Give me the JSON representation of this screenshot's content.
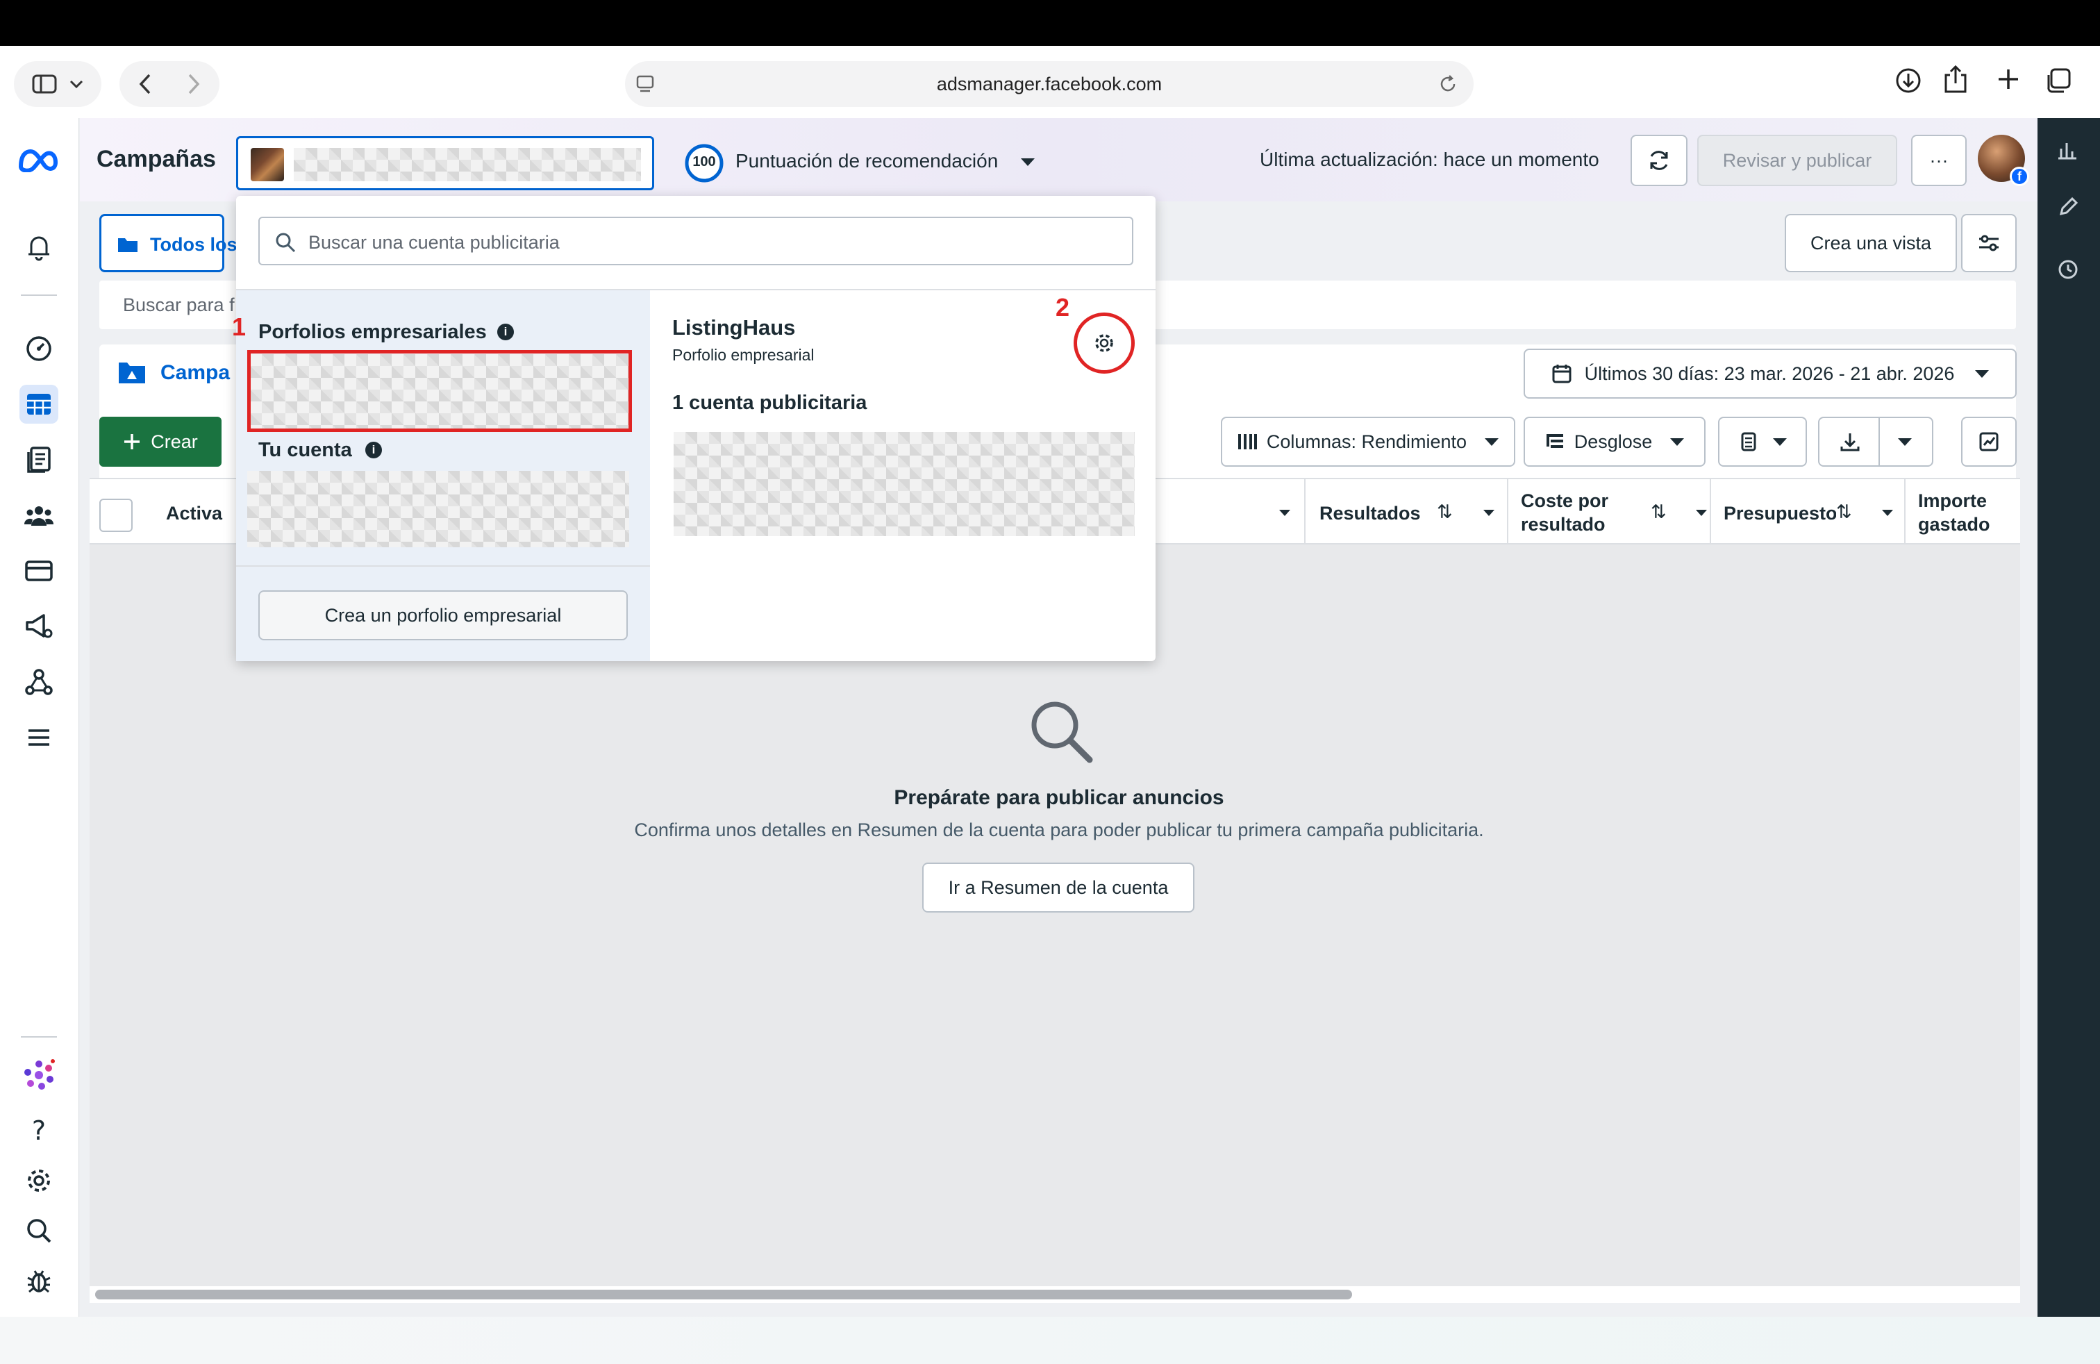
{
  "browser": {
    "url": "adsmanager.facebook.com"
  },
  "header": {
    "title": "Campañas",
    "score_value": "100",
    "score_label": "Puntuación de recomendación",
    "last_update": "Última actualización: hace un momento",
    "review_publish": "Revisar y publicar",
    "more": "···"
  },
  "toolbar_row": {
    "all_label": "Todos los",
    "create_view": "Crea una vista",
    "search_placeholder": "Buscar para f",
    "campaigns_tab": "Campa",
    "date_range": "Últimos 30 días: 23 mar. 2026 - 21 abr. 2026",
    "create_button": "Crear",
    "columns": "Columnas: Rendimiento",
    "breakdown": "Desglose"
  },
  "table": {
    "col_active": "Activa",
    "col_results": "Resultados",
    "col_cost_line1": "Coste por",
    "col_cost_line2": "resultado",
    "col_budget": "Presupuesto",
    "col_spent_line1": "Importe",
    "col_spent_line2": "gastado"
  },
  "empty_state": {
    "title": "Prepárate para publicar anuncios",
    "description": "Confirma unos detalles en Resumen de la cuenta para poder publicar tu primera campaña publicitaria.",
    "button": "Ir a Resumen de la cuenta"
  },
  "dropdown": {
    "search_placeholder": "Buscar una cuenta publicitaria",
    "section_business": "Porfolios empresariales",
    "section_your_account": "Tu cuenta",
    "create_portfolio": "Crea un porfolio empresarial",
    "portfolio_name": "ListingHaus",
    "portfolio_type": "Porfolio empresarial",
    "ad_accounts_count": "1 cuenta publicitaria"
  },
  "annotations": {
    "marker_1": "1",
    "marker_2": "2",
    "color": "#e02424"
  },
  "colors": {
    "accent_blue": "#0064d1",
    "create_green": "#1a7340",
    "meta_blue": "#0866ff",
    "sidebar_dark": "#1c2b33"
  }
}
